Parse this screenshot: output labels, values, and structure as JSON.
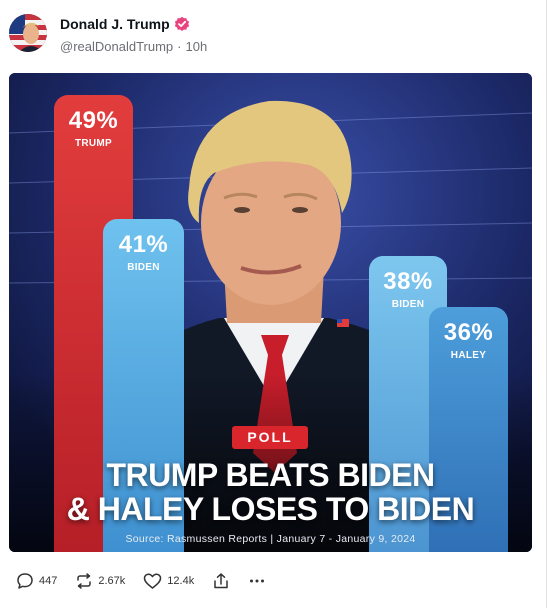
{
  "post": {
    "author_name": "Donald J. Trump",
    "handle": "@realDonaldTrump",
    "separator": "·",
    "time_ago": "10h"
  },
  "graphic": {
    "bars": [
      {
        "percent": "49%",
        "label": "TRUMP",
        "value": 49,
        "color": "#d6303a"
      },
      {
        "percent": "41%",
        "label": "BIDEN",
        "value": 41,
        "color": "#55a9e2"
      },
      {
        "percent": "38%",
        "label": "BIDEN",
        "value": 38,
        "color": "#62b0e4"
      },
      {
        "percent": "36%",
        "label": "HALEY",
        "value": 36,
        "color": "#3a82c6"
      }
    ],
    "badge": "POLL",
    "headline_line1": "TRUMP BEATS BIDEN",
    "headline_line2": "& HALEY LOSES TO BIDEN",
    "source": "Source: Rasmussen Reports | January 7 - January 9, 2024"
  },
  "actions": {
    "replies": "447",
    "retruths": "2.67k",
    "likes": "12.4k",
    "icons": [
      "reply-icon",
      "retruth-icon",
      "like-icon",
      "share-icon",
      "more-icon"
    ]
  },
  "colors": {
    "verified": "#e8437d",
    "meta_text": "#6c6f74"
  }
}
